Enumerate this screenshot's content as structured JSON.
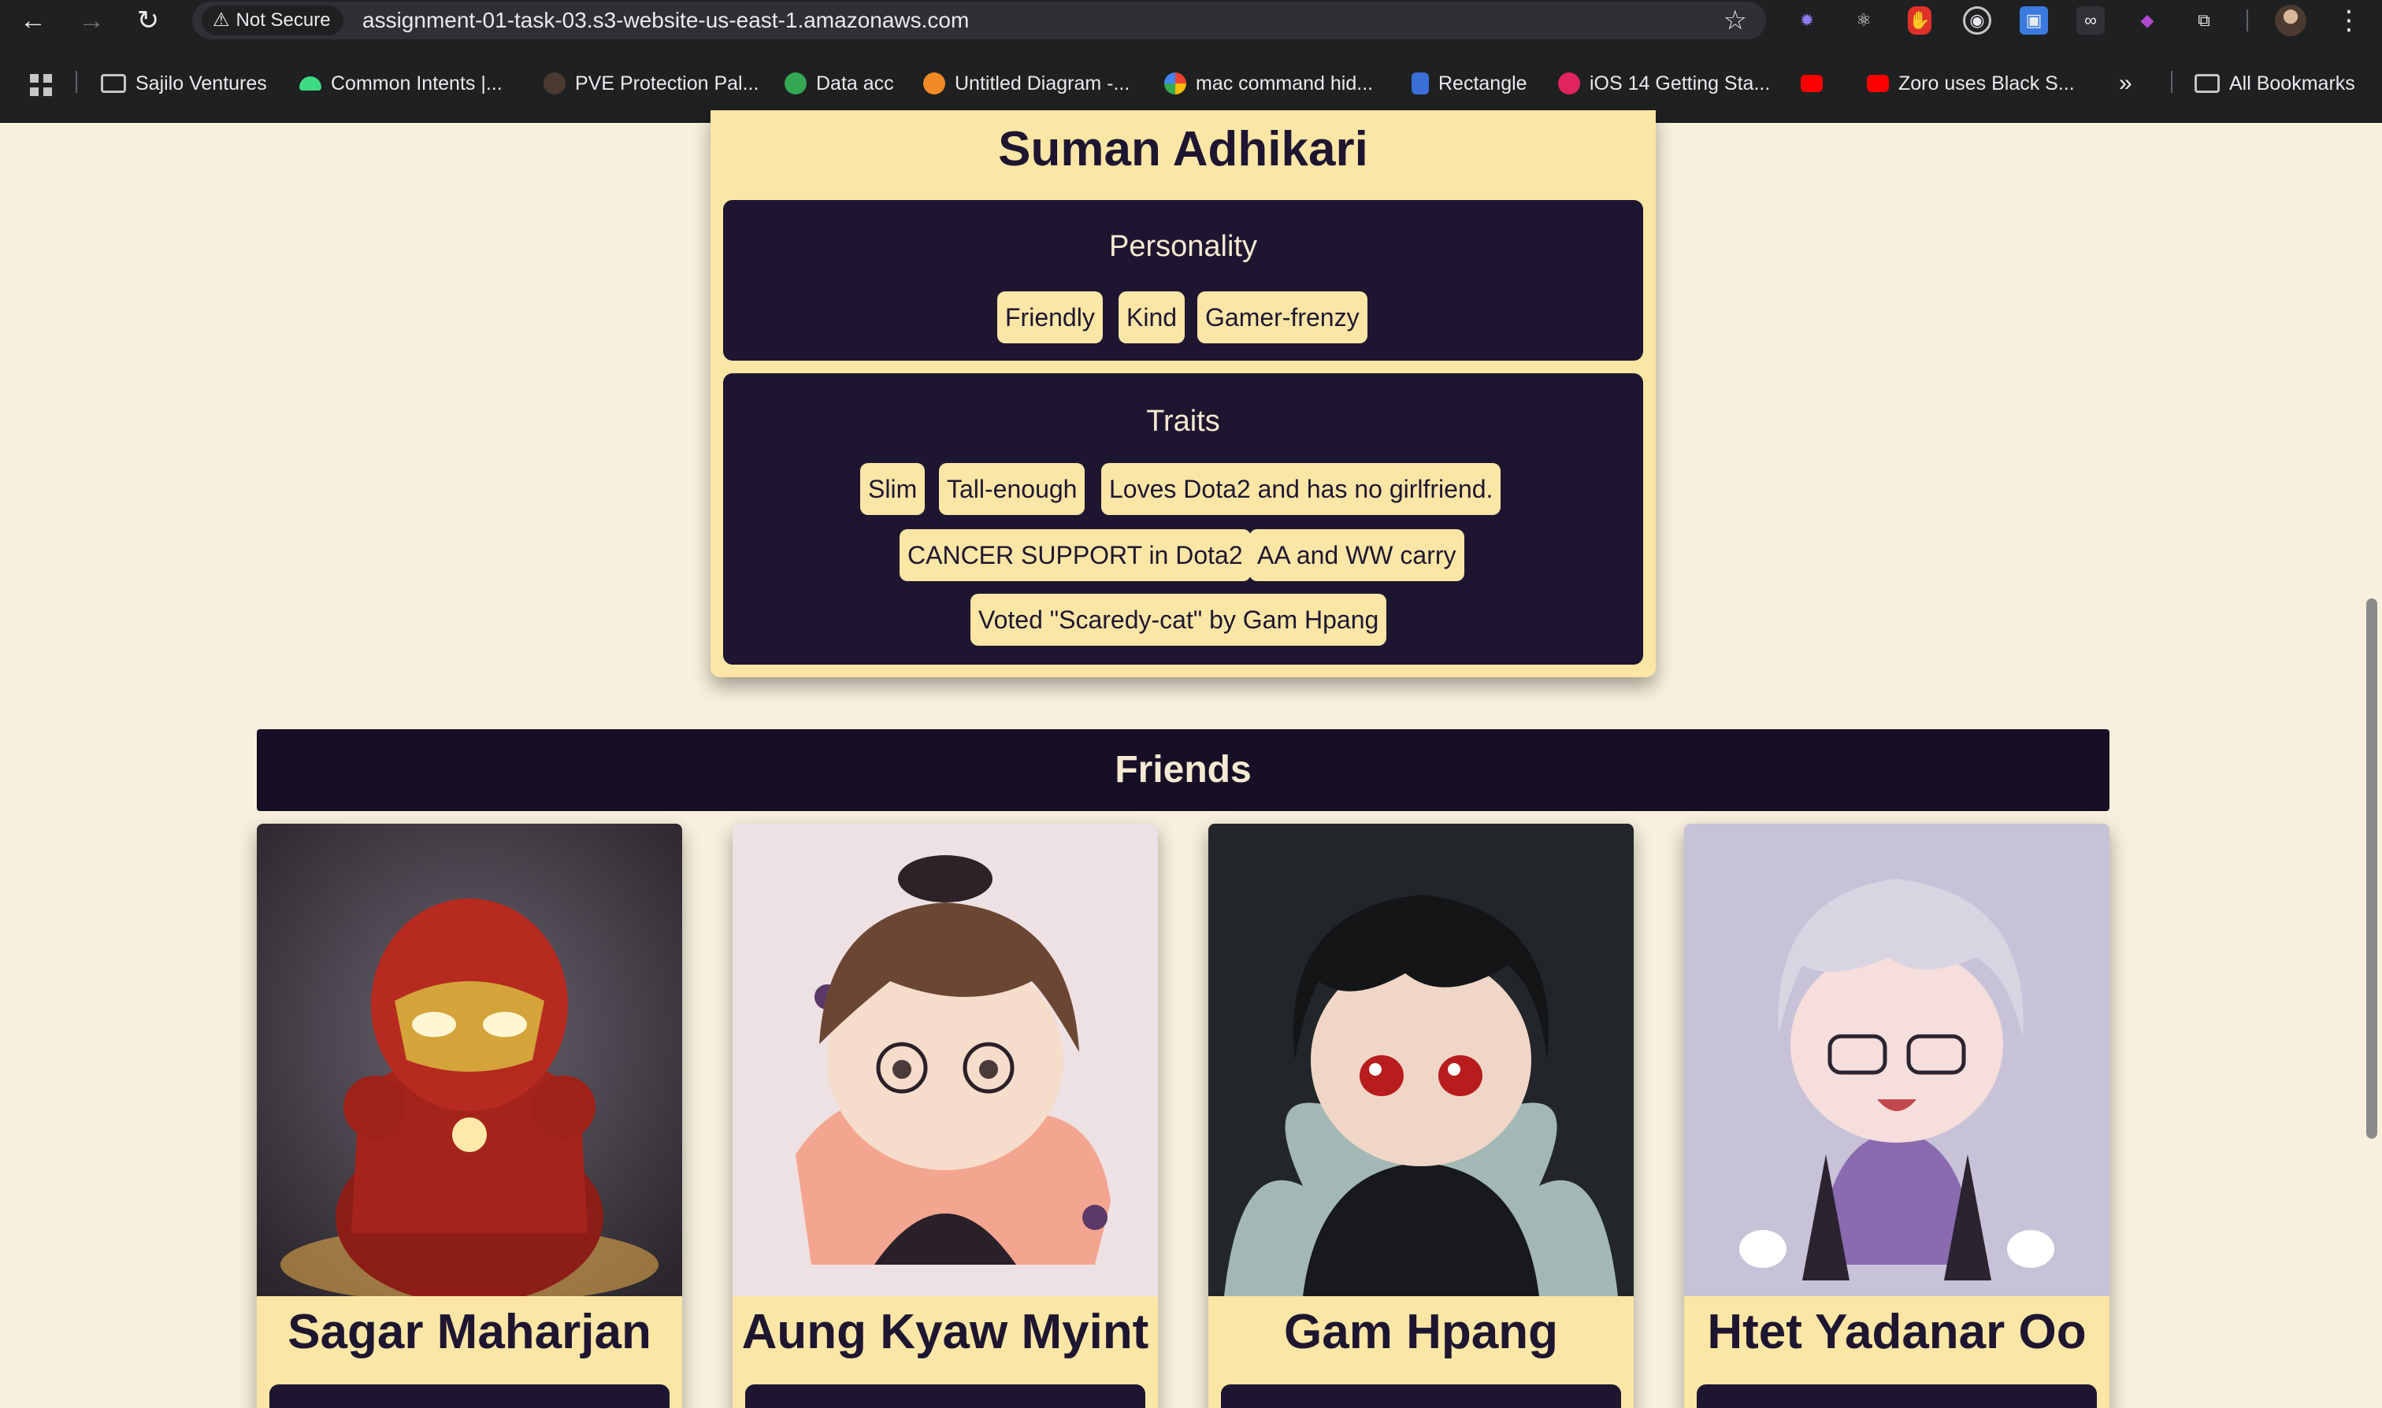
{
  "browser": {
    "security_label": "Not Secure",
    "url": "assignment-01-task-03.s3-website-us-east-1.amazonaws.com",
    "bookmarks": [
      "Sajilo Ventures",
      "Common Intents |...",
      "PVE Protection Pal...",
      "Data acc",
      "Untitled Diagram -...",
      "mac command hid...",
      "Rectangle",
      "iOS 14 Getting Sta...",
      "",
      "Zoro uses Black S..."
    ],
    "all_bookmarks": "All Bookmarks"
  },
  "profile": {
    "name": "Suman Adhikari",
    "personality_title": "Personality",
    "personality": [
      "Friendly",
      "Kind",
      "Gamer-frenzy"
    ],
    "traits_title": "Traits",
    "traits": [
      "Slim",
      "Tall-enough",
      "Loves Dota2 and has no girlfriend.",
      "CANCER SUPPORT in Dota2",
      "AA and WW carry",
      "Voted \"Scaredy-cat\" by Gam Hpang"
    ]
  },
  "friends": {
    "title": "Friends",
    "items": [
      {
        "name": "Sagar Maharjan"
      },
      {
        "name": "Aung Kyaw Myint"
      },
      {
        "name": "Gam Hpang"
      },
      {
        "name": "Htet Yadanar Oo"
      }
    ]
  },
  "colors": {
    "page_bg": "#f8f0dd",
    "card_bg": "#fbe6a6",
    "dark": "#1e1630",
    "friends_bar": "#160f26"
  }
}
